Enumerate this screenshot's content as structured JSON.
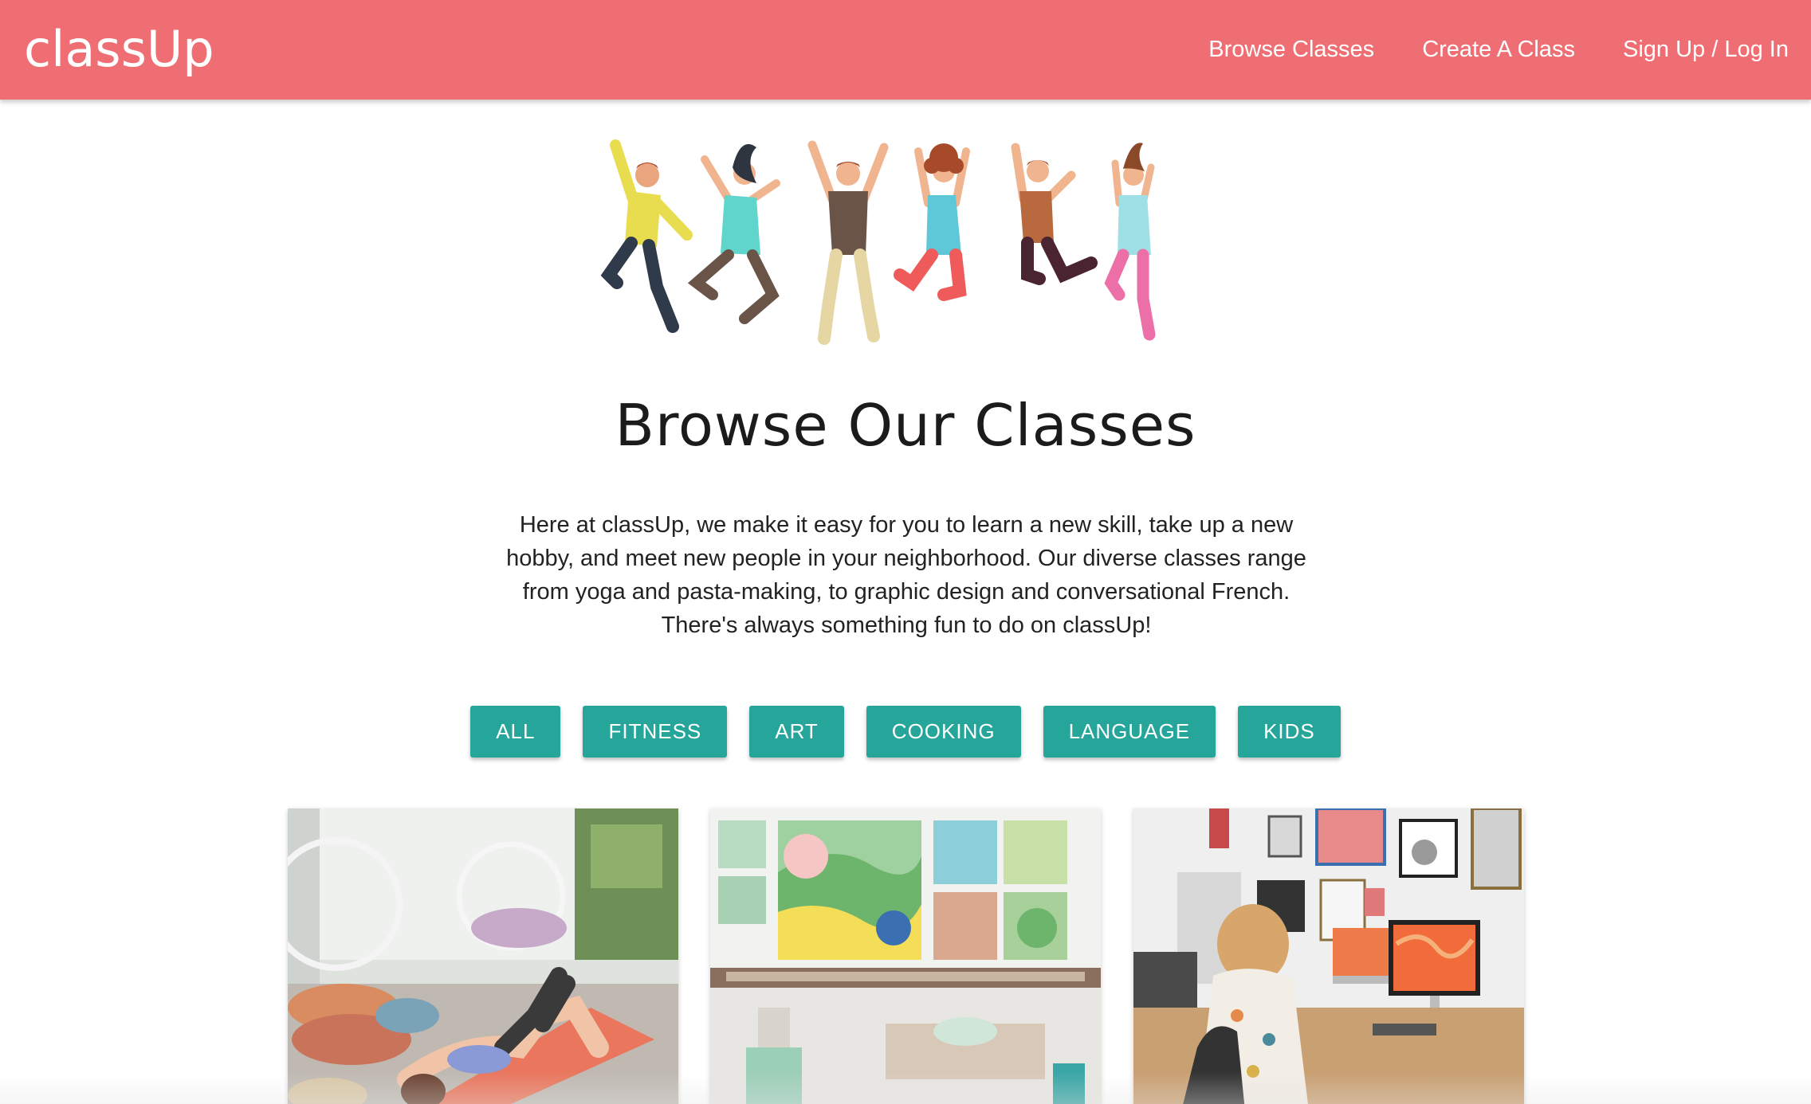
{
  "nav": {
    "brand": "classUp",
    "links": [
      "Browse Classes",
      "Create A Class",
      "Sign Up / Log In"
    ]
  },
  "page": {
    "title": "Browse Our Classes",
    "intro": "Here at classUp, we make it easy for you to learn a new skill, take up a new hobby, and meet new people in your neighborhood. Our diverse classes range from yoga and pasta-making, to graphic design and conversational French. There's always something fun to do on classUp!"
  },
  "filters": [
    "ALL",
    "FITNESS",
    "ART",
    "COOKING",
    "LANGUAGE",
    "KIDS"
  ],
  "colors": {
    "navbar": "#ee6e73",
    "button": "#26a69a"
  },
  "cards": [
    {
      "image": "yoga-class-photo"
    },
    {
      "image": "painting-studio-photo"
    },
    {
      "image": "graphic-design-desk-photo"
    }
  ]
}
